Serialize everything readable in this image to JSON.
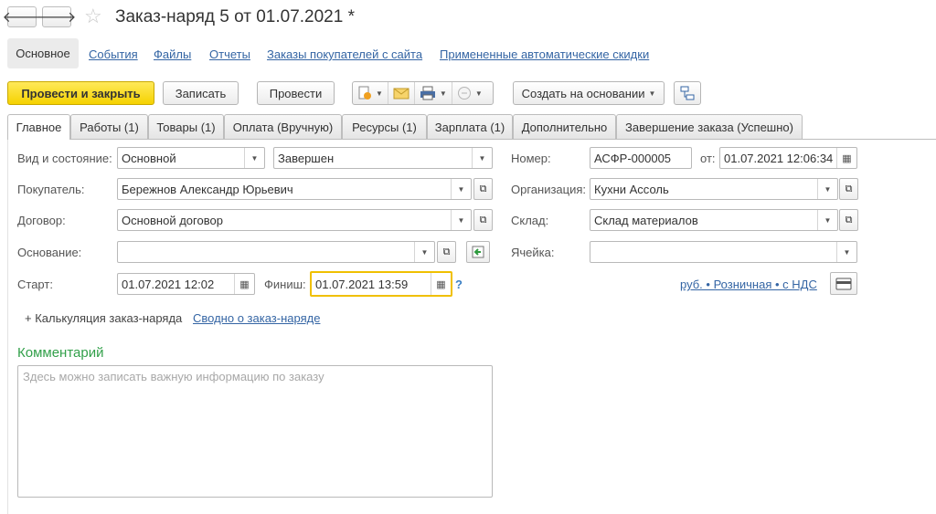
{
  "window": {
    "title": "Заказ-наряд 5 от 01.07.2021 *"
  },
  "sections": {
    "active": "Основное",
    "links": [
      "События",
      "Файлы",
      "Отчеты",
      "Заказы покупателей с сайта",
      "Примененные автоматические скидки"
    ]
  },
  "toolbar": {
    "post_close": "Провести и закрыть",
    "save": "Записать",
    "post": "Провести",
    "create_based": "Создать на основании"
  },
  "tabs": [
    "Главное",
    "Работы (1)",
    "Товары (1)",
    "Оплата (Вручную)",
    "Ресурсы (1)",
    "Зарплата (1)",
    "Дополнительно",
    "Завершение заказа (Успешно)"
  ],
  "form": {
    "kind_label": "Вид и состояние:",
    "kind_value": "Основной",
    "state_value": "Завершен",
    "buyer_label": "Покупатель:",
    "buyer_value": "Бережнов Александр Юрьевич",
    "contract_label": "Договор:",
    "contract_value": "Основной договор",
    "basis_label": "Основание:",
    "basis_value": "",
    "start_label": "Старт:",
    "start_value": "01.07.2021 12:02",
    "finish_label": "Финиш:",
    "finish_value": "01.07.2021 13:59",
    "help": "?",
    "number_label": "Номер:",
    "number_value": "АСФР-000005",
    "from_label": "от:",
    "date_value": "01.07.2021 12:06:34",
    "org_label": "Организация:",
    "org_value": "Кухни Ассоль",
    "warehouse_label": "Склад:",
    "warehouse_value": "Склад материалов",
    "cell_label": "Ячейка:",
    "cell_value": "",
    "price_link": "руб. • Розничная • с НДС",
    "calc_link": "+ Калькуляция заказ-наряда",
    "summary_link": "Сводно о заказ-наряде"
  },
  "comment": {
    "title": "Комментарий",
    "placeholder": "Здесь можно записать важную информацию по заказу"
  }
}
